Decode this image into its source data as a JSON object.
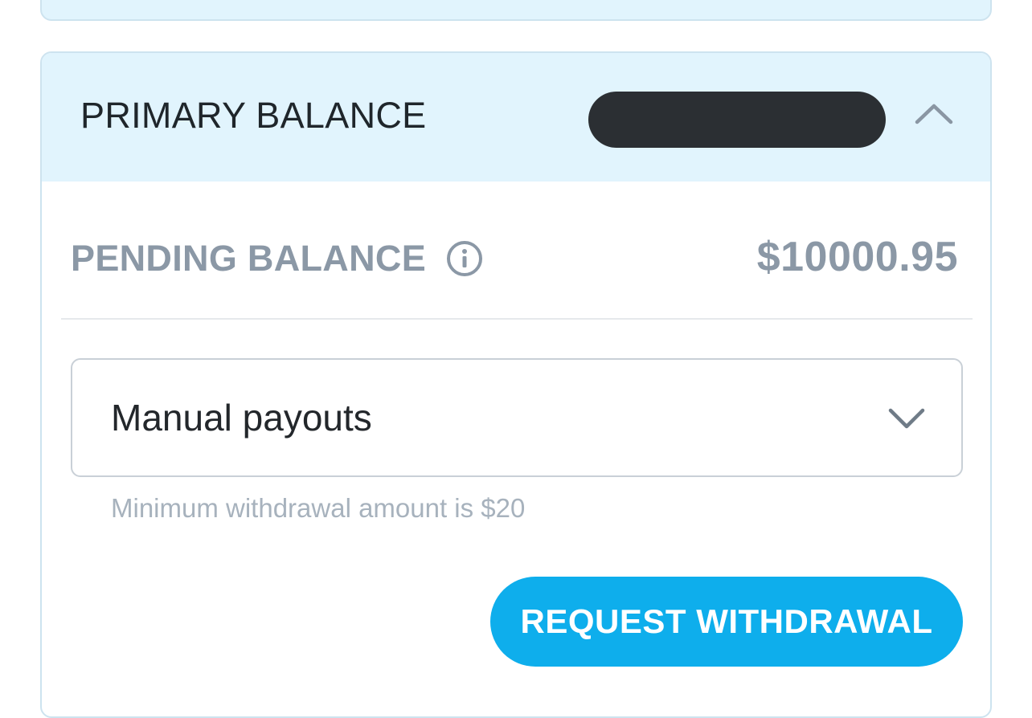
{
  "primary_balance": {
    "title": "PRIMARY BALANCE",
    "collapse_icon": "chevron-up-icon"
  },
  "pending_balance": {
    "label": "PENDING BALANCE",
    "info_icon": "info-icon",
    "value": "$10000.95"
  },
  "payout_select": {
    "value": "Manual payouts",
    "icon": "chevron-down-icon"
  },
  "helper_text": "Minimum withdrawal amount is $20",
  "actions": {
    "request_withdrawal_label": "REQUEST WITHDRAWAL"
  },
  "colors": {
    "header_bg": "#e1f4fd",
    "accent": "#0eaeec",
    "muted_text": "#8b98a6"
  }
}
